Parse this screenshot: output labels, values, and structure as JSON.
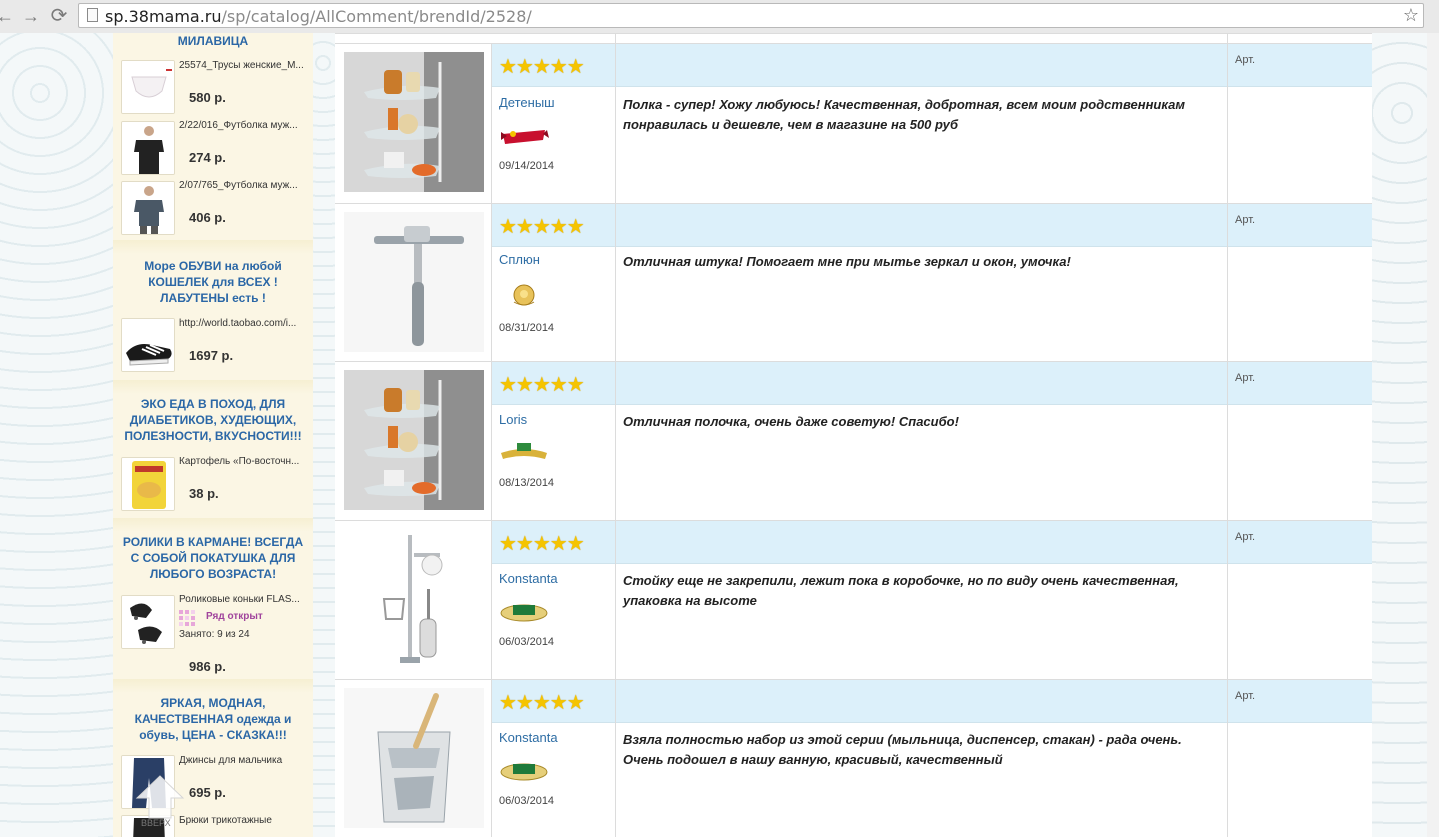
{
  "browser": {
    "url_host": "sp.38mama.ru",
    "url_path": "/sp/catalog/AllComment/brendId/2528/"
  },
  "sidebar": {
    "top_title": "МИЛАВИЦА",
    "top_items": [
      {
        "name": "25574_Трусы женские_М...",
        "price": "580 р."
      },
      {
        "name": "2/22/016_Футболка муж...",
        "price": "274 р."
      },
      {
        "name": "2/07/765_Футболка муж...",
        "price": "406 р."
      }
    ],
    "blocks": [
      {
        "title_lines": [
          "Море ОБУВИ на любой",
          "КОШЕЛЕК для ВСЕХ !",
          "ЛАБУТЕНЫ есть !"
        ],
        "item": {
          "name": "http://world.taobao.com/i...",
          "price": "1697 р."
        }
      },
      {
        "title_lines": [
          "ЭКО ЕДА В ПОХОД, ДЛЯ",
          "ДИАБЕТИКОВ, ХУДЕЮЩИХ,",
          "ПОЛЕЗНОСТИ, ВКУСНОСТИ!!!"
        ],
        "item": {
          "name": "Картофель «По-восточн...",
          "price": "38 р."
        }
      },
      {
        "title_lines": [
          "РОЛИКИ В КАРМАНЕ! ВСЕГДА",
          "С СОБОЙ ПОКАТУШКА ДЛЯ",
          "ЛЮБОГО ВОЗРАСТА!"
        ],
        "item": {
          "name": "Роликовые коньки FLAS...",
          "status": "Ряд открыт",
          "busy": "Занято: 9 из 24",
          "price": "986 р."
        }
      },
      {
        "title_lines": [
          "ЯРКАЯ, МОДНАЯ,",
          "КАЧЕСТВЕННАЯ одежда и",
          "обувь, ЦЕНА - СКАЗКА!!!"
        ],
        "item": {
          "name": "Джинсы для мальчика",
          "price": "695 р."
        },
        "item2": {
          "name": "Брюки трикотажные"
        }
      }
    ],
    "up_label": "ВВЕРХ"
  },
  "reviews": [
    {
      "stars": "★★★★★",
      "art": "Арт.",
      "user": "Детеныш",
      "date": "09/14/2014",
      "comment": "Полка - супер! Хожу любуюсь! Качественная, добротная, всем моим родственникам понравилась и дешевле, чем в магазине на 500 руб"
    },
    {
      "stars": "★★★★★",
      "art": "Арт.",
      "user": "Сплюн",
      "date": "08/31/2014",
      "comment": "Отличная штука! Помогает мне при мытье зеркал и окон, умочка!"
    },
    {
      "stars": "★★★★★",
      "art": "Арт.",
      "user": "Loris",
      "date": "08/13/2014",
      "comment": "Отличная полочка, очень даже советую! Спасибо!"
    },
    {
      "stars": "★★★★★",
      "art": "Арт.",
      "user": "Konstanta",
      "date": "06/03/2014",
      "comment": "Стойку еще не закрепили, лежит пока в коробочке, но по виду очень качественная, упаковка на высоте"
    },
    {
      "stars": "★★★★★",
      "art": "Арт.",
      "user": "Konstanta",
      "date": "06/03/2014",
      "comment": "Взяла полностью набор из этой серии (мыльница, диспенсер, стакан) - рада очень. Очень подошел в нашу ванную, красивый, качественный"
    }
  ],
  "colors": {
    "link": "#2e6da4",
    "header_bg": "#dcf0fa",
    "sidebar_bg": "#fbf6e4",
    "star": "#f5c400"
  }
}
